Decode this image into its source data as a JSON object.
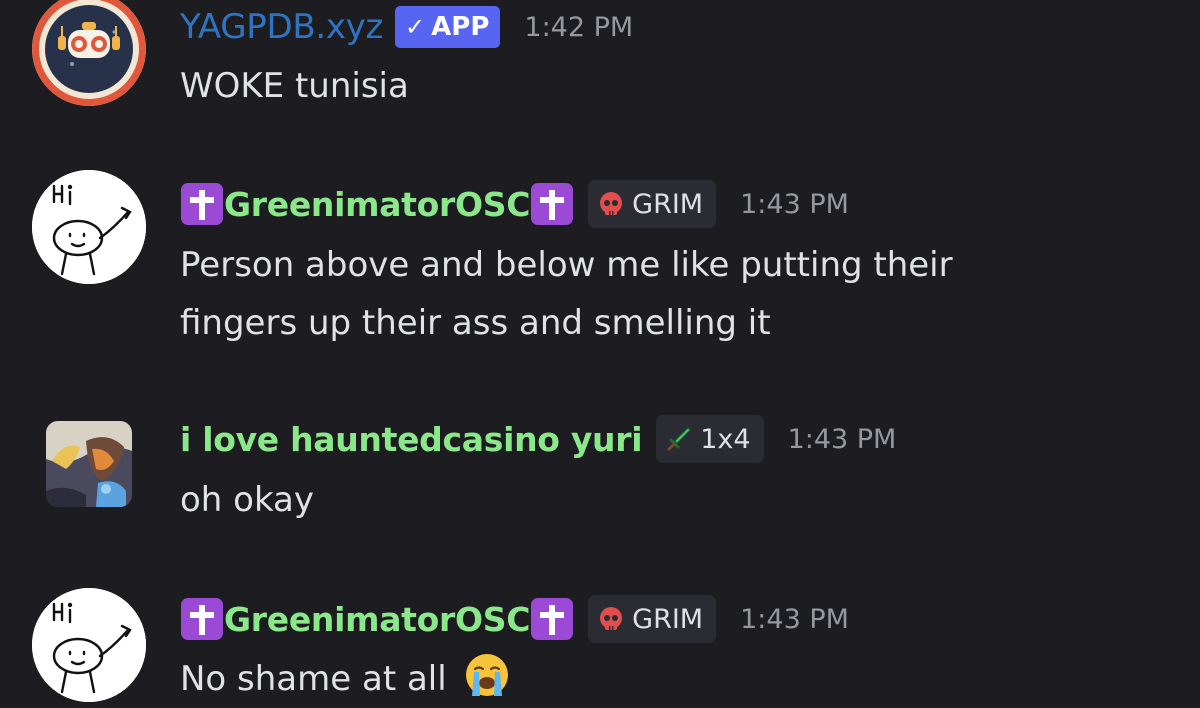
{
  "messages": [
    {
      "username": "YAGPDB.xyz",
      "badge": {
        "check_icon": "check-icon",
        "label": "APP",
        "color": "#5865f2"
      },
      "timestamp": "1:42 PM",
      "text": "WOKE tunisia",
      "avatar": "robot-avatar",
      "name_color": "#2f74c0"
    },
    {
      "username": "GreenimatorOSC",
      "name_prefix_icon": "latin-cross-icon",
      "name_suffix_icon": "latin-cross-icon",
      "tag": {
        "icon": "skull-icon",
        "label": "GRIM"
      },
      "timestamp": "1:43 PM",
      "text_lines": [
        "Person above and below me like putting their",
        "fingers up their ass and smelling it"
      ],
      "avatar": "hi-doodle-avatar",
      "name_color": "#8be88a"
    },
    {
      "username": "i love hauntedcasino yuri",
      "tag": {
        "icon": "sword-icon",
        "label": "1x4"
      },
      "timestamp": "1:43 PM",
      "text": "oh okay",
      "avatar": "artwork-avatar",
      "name_color": "#8be88a"
    },
    {
      "username": "GreenimatorOSC",
      "name_prefix_icon": "latin-cross-icon",
      "name_suffix_icon": "latin-cross-icon",
      "tag": {
        "icon": "skull-icon",
        "label": "GRIM"
      },
      "timestamp": "1:43 PM",
      "text": "No shame at all",
      "trailing_emoji": "loudly-crying-face-icon",
      "avatar": "hi-doodle-avatar",
      "name_color": "#8be88a"
    }
  ],
  "colors": {
    "background": "#1c1c21",
    "message_text": "#e1e2e6",
    "timestamp": "#9698a0",
    "role_green": "#8be88a",
    "bot_blue": "#2f74c0",
    "cross_purple": "#9b4ad6"
  }
}
